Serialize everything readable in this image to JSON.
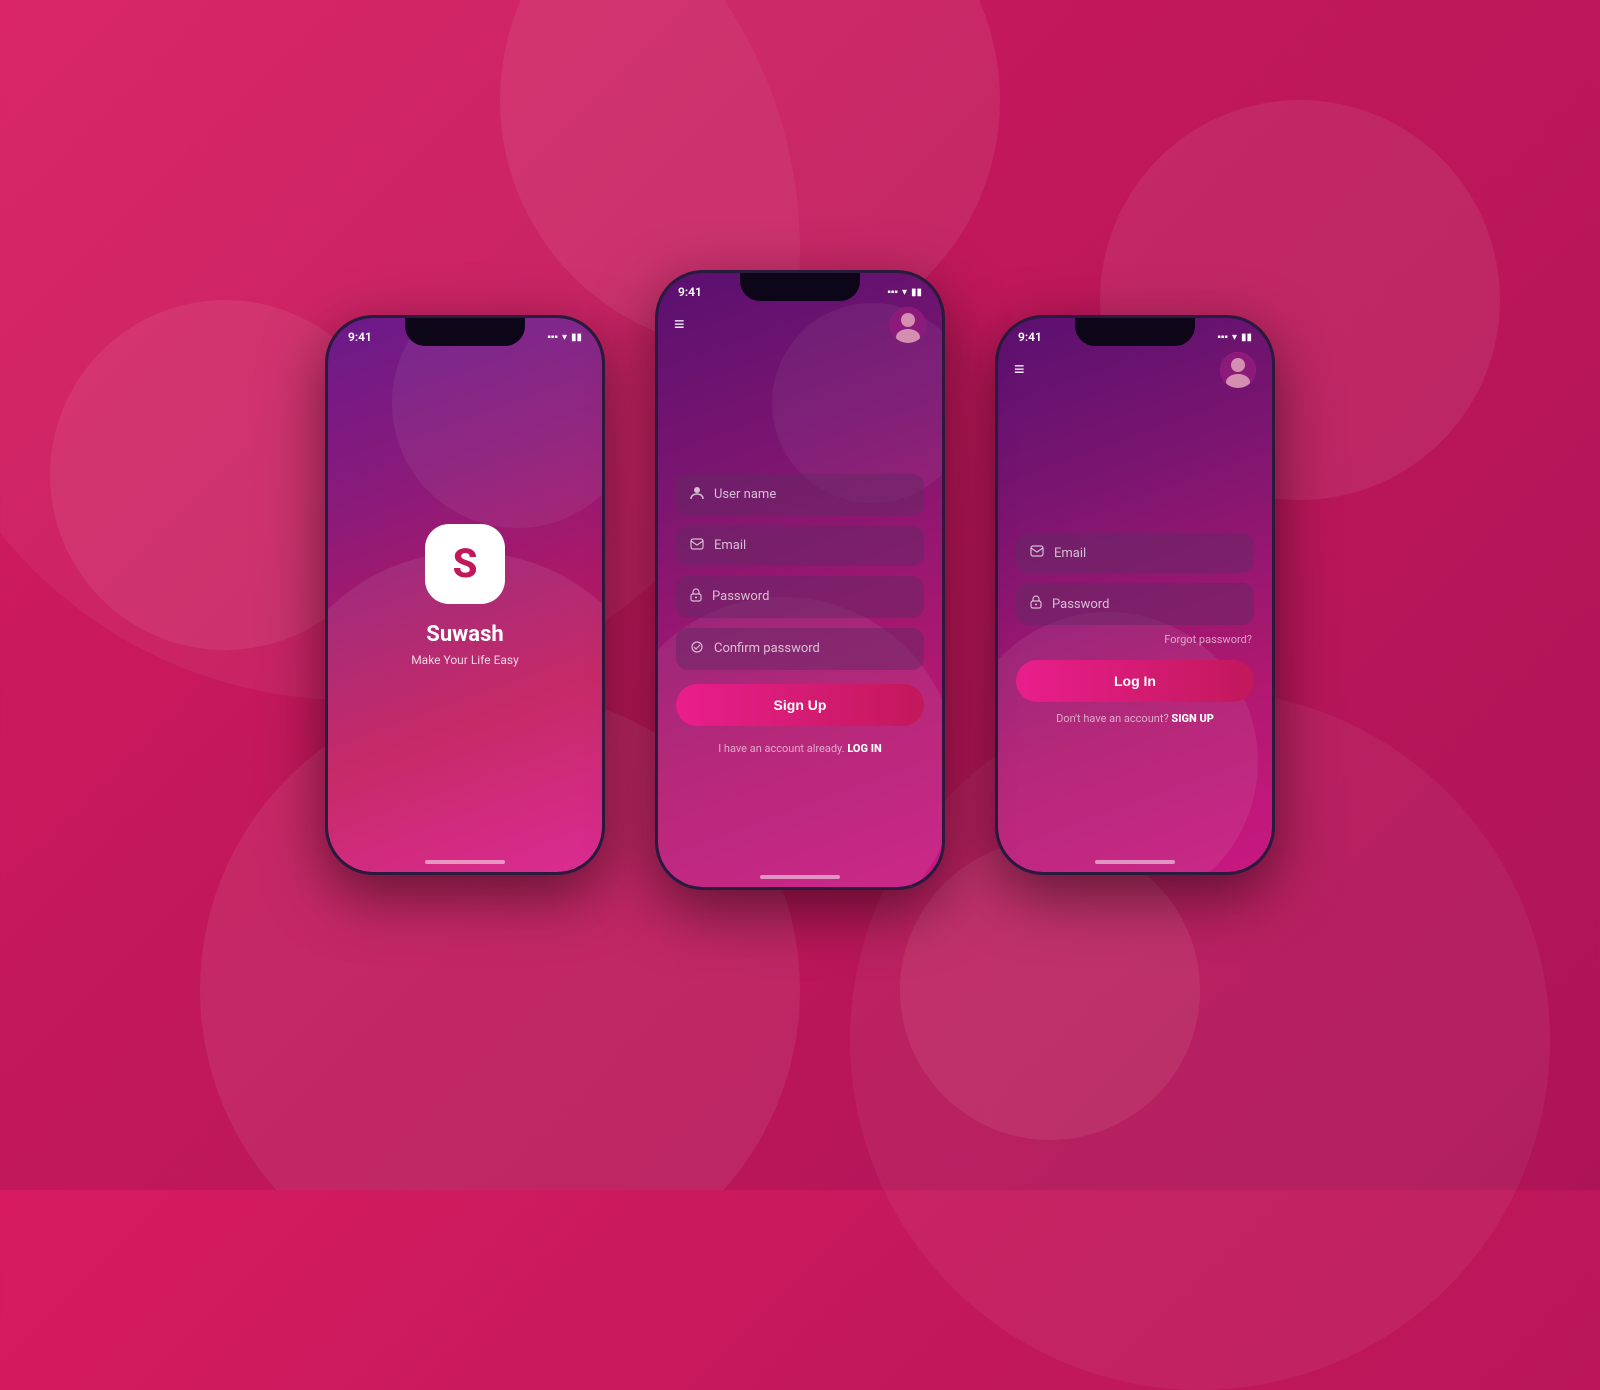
{
  "background": {
    "color": "#c2185b"
  },
  "phone_splash": {
    "status_time": "9:41",
    "app_logo_letter": "S",
    "app_name": "Suwash",
    "app_tagline": "Make Your Life Easy"
  },
  "phone_signup": {
    "status_time": "9:41",
    "menu_icon": "≡",
    "fields": [
      {
        "icon": "👤",
        "label": "User name"
      },
      {
        "icon": "✉",
        "label": "Email"
      },
      {
        "icon": "🔒",
        "label": "Password"
      },
      {
        "icon": "🔑",
        "label": "Confirm password"
      }
    ],
    "button_label": "Sign Up",
    "footer_text": "I have an account already.",
    "footer_link": "LOG IN"
  },
  "phone_login": {
    "status_time": "9:41",
    "menu_icon": "≡",
    "fields": [
      {
        "icon": "✉",
        "label": "Email"
      },
      {
        "icon": "🔒",
        "label": "Password"
      }
    ],
    "forgot_password": "Forgot password?",
    "button_label": "Log In",
    "footer_text": "Don't have an account?",
    "footer_link": "SIGN UP"
  }
}
